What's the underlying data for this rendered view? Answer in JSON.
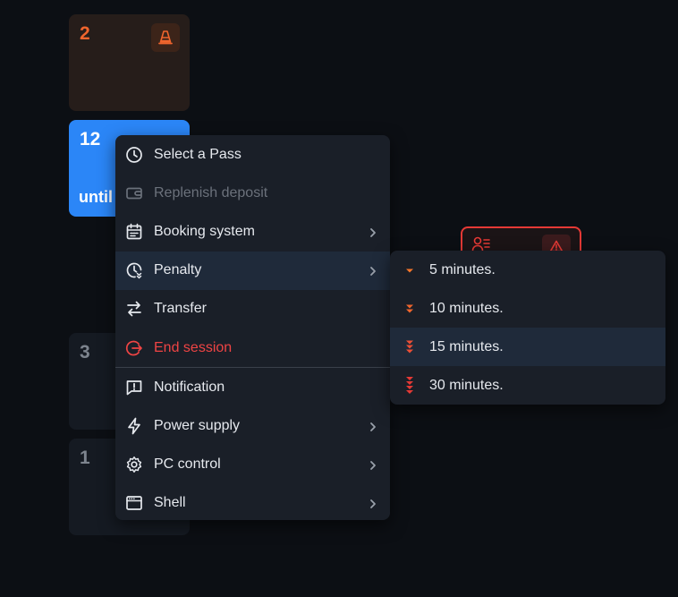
{
  "tiles": [
    {
      "id": "2",
      "number": "2"
    },
    {
      "id": "12",
      "number": "12",
      "subtitle": "until"
    },
    {
      "id": "3",
      "number": "3"
    },
    {
      "id": "1",
      "number": "1"
    }
  ],
  "context_menu": {
    "items": [
      {
        "label": "Select a Pass",
        "icon": "clock-icon",
        "state": "normal",
        "submenu": false
      },
      {
        "label": "Replenish deposit",
        "icon": "wallet-icon",
        "state": "disabled",
        "submenu": false
      },
      {
        "label": "Booking system",
        "icon": "calendar-icon",
        "state": "normal",
        "submenu": true
      },
      {
        "label": "Penalty",
        "icon": "clock-penalty-icon",
        "state": "active",
        "submenu": true
      },
      {
        "label": "Transfer",
        "icon": "transfer-arrows-icon",
        "state": "normal",
        "submenu": false
      },
      {
        "label": "End session",
        "icon": "logout-icon",
        "state": "danger",
        "submenu": false
      },
      {
        "label": "Notification",
        "icon": "message-alert-icon",
        "state": "normal",
        "submenu": false
      },
      {
        "label": "Power supply",
        "icon": "lightning-icon",
        "state": "normal",
        "submenu": true
      },
      {
        "label": "PC control",
        "icon": "gear-icon",
        "state": "normal",
        "submenu": true
      },
      {
        "label": "Shell",
        "icon": "window-icon",
        "state": "normal",
        "submenu": true
      }
    ]
  },
  "penalty_submenu": {
    "items": [
      {
        "label": "5 minutes.",
        "level": 1
      },
      {
        "label": "10 minutes.",
        "level": 2
      },
      {
        "label": "15 minutes.",
        "level": 3,
        "highlighted": true
      },
      {
        "label": "30 minutes.",
        "level": 4
      }
    ]
  },
  "colors": {
    "background": "#0c0f14",
    "menu_bg": "#1a1f28",
    "menu_active": "#1f2a3a",
    "accent_blue": "#2b86f7",
    "danger_red": "#ef4444",
    "orange": "#f0652d"
  }
}
